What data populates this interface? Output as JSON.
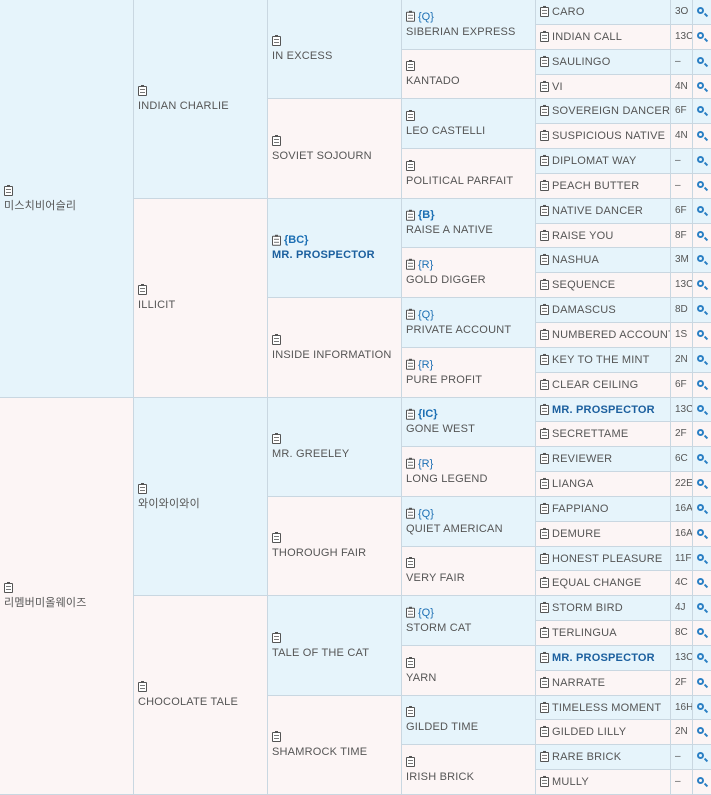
{
  "gen1": [
    {
      "name": "미스치비어슬리"
    },
    {
      "name": "리멤버미올웨이즈"
    }
  ],
  "gen2": [
    {
      "name": "INDIAN CHARLIE"
    },
    {
      "name": "ILLICIT"
    },
    {
      "name": "와이와이와이"
    },
    {
      "name": "CHOCOLATE TALE"
    }
  ],
  "gen3": [
    {
      "name": "IN EXCESS"
    },
    {
      "name": "SOVIET SOJOURN"
    },
    {
      "name": "MR. PROSPECTOR",
      "tag": "{BC}",
      "highlight": true
    },
    {
      "name": "INSIDE INFORMATION"
    },
    {
      "name": "MR. GREELEY"
    },
    {
      "name": "THOROUGH FAIR"
    },
    {
      "name": "TALE OF THE CAT"
    },
    {
      "name": "SHAMROCK TIME"
    }
  ],
  "gen4": [
    {
      "name": "SIBERIAN EXPRESS",
      "tag": "{Q}"
    },
    {
      "name": "KANTADO"
    },
    {
      "name": "LEO CASTELLI"
    },
    {
      "name": "POLITICAL PARFAIT"
    },
    {
      "name": "RAISE A NATIVE",
      "tag": "{B}"
    },
    {
      "name": "GOLD DIGGER",
      "tag": "{R}"
    },
    {
      "name": "PRIVATE ACCOUNT",
      "tag": "{Q}"
    },
    {
      "name": "PURE PROFIT",
      "tag": "{R}"
    },
    {
      "name": "GONE WEST",
      "tag": "{IC}"
    },
    {
      "name": "LONG LEGEND",
      "tag": "{R}"
    },
    {
      "name": "QUIET AMERICAN",
      "tag": "{Q}"
    },
    {
      "name": "VERY FAIR"
    },
    {
      "name": "STORM CAT",
      "tag": "{Q}"
    },
    {
      "name": "YARN"
    },
    {
      "name": "GILDED TIME"
    },
    {
      "name": "IRISH BRICK"
    }
  ],
  "gen5": [
    {
      "name": "CARO",
      "code": "3O"
    },
    {
      "name": "INDIAN CALL",
      "code": "13C"
    },
    {
      "name": "SAULINGO",
      "code": "–"
    },
    {
      "name": "VI",
      "code": "4N"
    },
    {
      "name": "SOVEREIGN DANCER",
      "code": "6F"
    },
    {
      "name": "SUSPICIOUS NATIVE",
      "code": "4N"
    },
    {
      "name": "DIPLOMAT WAY",
      "code": "–"
    },
    {
      "name": "PEACH BUTTER",
      "code": "–"
    },
    {
      "name": "NATIVE DANCER",
      "code": "6F"
    },
    {
      "name": "RAISE YOU",
      "code": "8F"
    },
    {
      "name": "NASHUA",
      "code": "3M"
    },
    {
      "name": "SEQUENCE",
      "code": "13C"
    },
    {
      "name": "DAMASCUS",
      "code": "8D"
    },
    {
      "name": "NUMBERED ACCOUNT",
      "code": "1S"
    },
    {
      "name": "KEY TO THE MINT",
      "code": "2N"
    },
    {
      "name": "CLEAR CEILING",
      "code": "6F"
    },
    {
      "name": "MR. PROSPECTOR",
      "code": "13C",
      "highlight": true
    },
    {
      "name": "SECRETTAME",
      "code": "2F"
    },
    {
      "name": "REVIEWER",
      "code": "6C"
    },
    {
      "name": "LIANGA",
      "code": "22E"
    },
    {
      "name": "FAPPIANO",
      "code": "16A"
    },
    {
      "name": "DEMURE",
      "code": "16A"
    },
    {
      "name": "HONEST PLEASURE",
      "code": "11F"
    },
    {
      "name": "EQUAL CHANGE",
      "code": "4C"
    },
    {
      "name": "STORM BIRD",
      "code": "4J"
    },
    {
      "name": "TERLINGUA",
      "code": "8C"
    },
    {
      "name": "MR. PROSPECTOR",
      "code": "13C",
      "highlight": true
    },
    {
      "name": "NARRATE",
      "code": "2F"
    },
    {
      "name": "TIMELESS MOMENT",
      "code": "16H"
    },
    {
      "name": "GILDED LILLY",
      "code": "2N"
    },
    {
      "name": "RARE BRICK",
      "code": "–"
    },
    {
      "name": "MULLY",
      "code": "–"
    }
  ]
}
